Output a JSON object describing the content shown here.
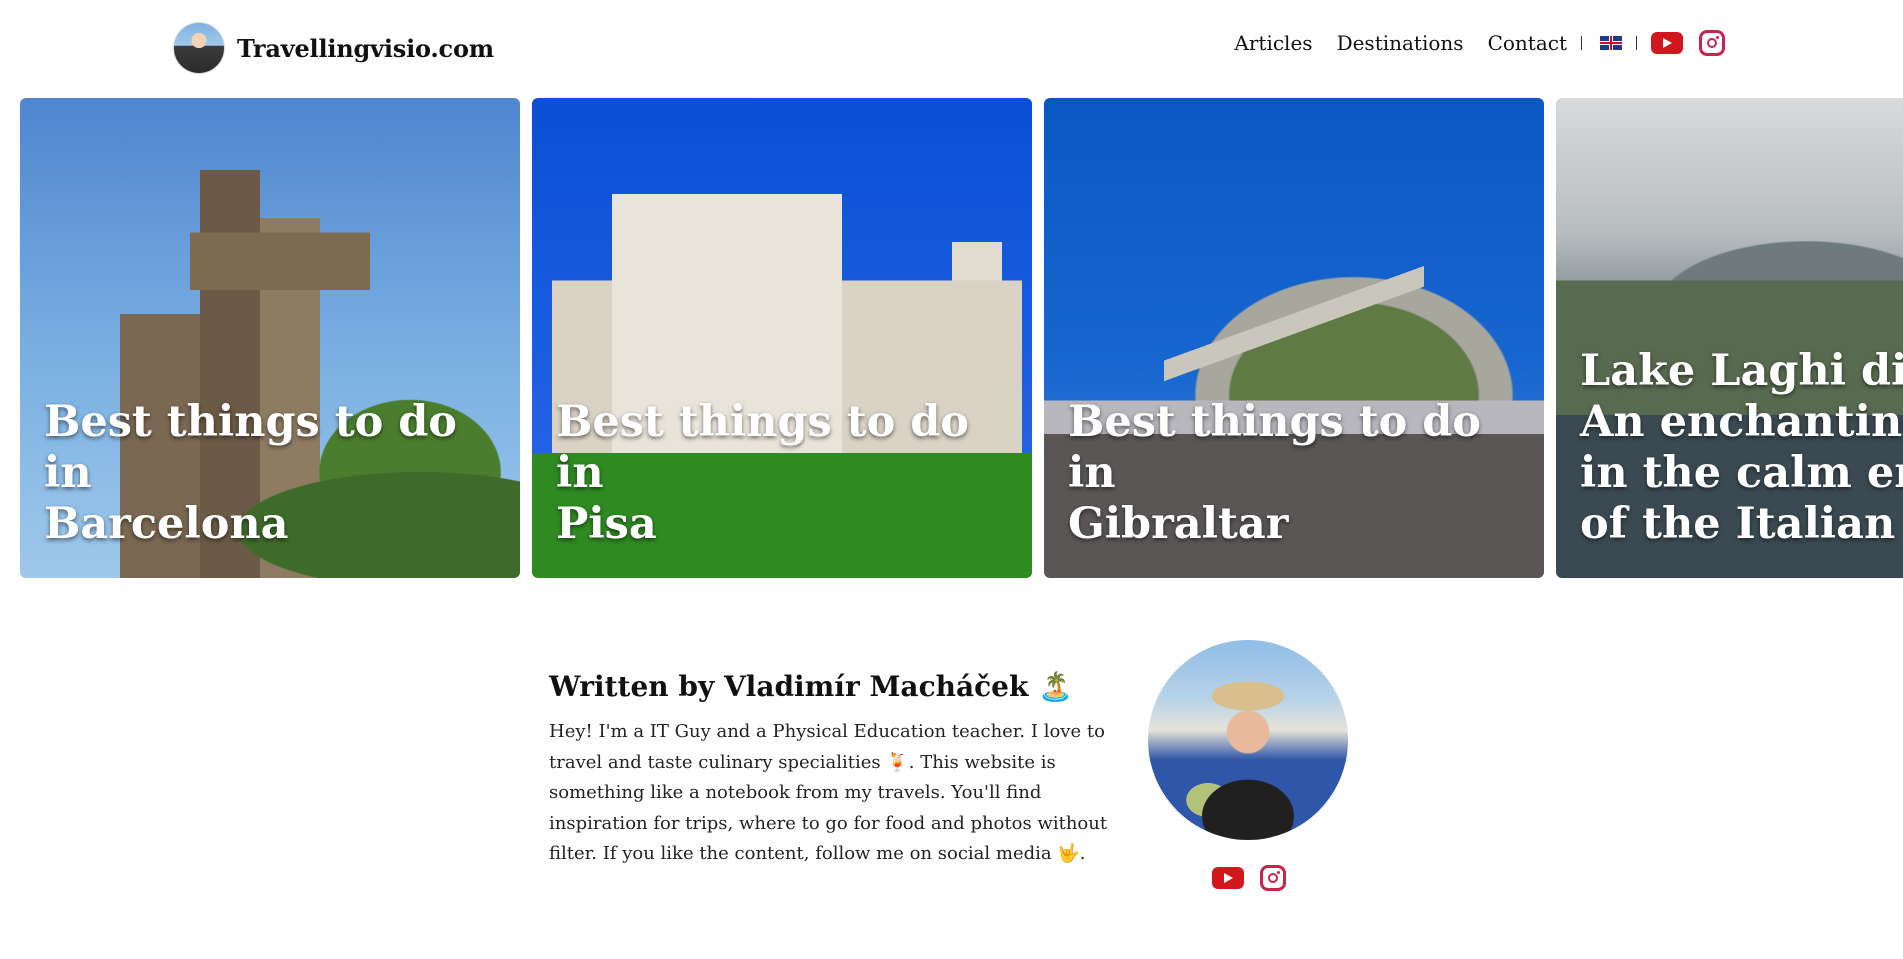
{
  "header": {
    "site_name": "Travellingvisio.com",
    "nav": [
      "Articles",
      "Destinations",
      "Contact"
    ],
    "language": "English",
    "icons": [
      "uk-flag-icon",
      "youtube-icon",
      "instagram-icon"
    ]
  },
  "cards": [
    {
      "title": "Best things to do in\nBarcelona"
    },
    {
      "title": "Best things to do in\nPisa"
    },
    {
      "title": "Best things to do in\nGibraltar"
    },
    {
      "title": "Lake Laghi di Fu\nAn enchanting v\nin the calm emb\nof the Italian Alp"
    }
  ],
  "author": {
    "heading": "Written by Vladimír Macháček 🏝️",
    "bio": "Hey! I'm a IT Guy and a Physical Education teacher. I love to travel and taste culinary specialities 🍹. This website is something like a notebook from my travels. You'll find inspiration for trips, where to go for food and photos without filter. If you like the content, follow me on social media 🤟.",
    "social_icons": [
      "youtube-icon",
      "instagram-icon"
    ]
  },
  "colors": {
    "youtube": "#d1171b",
    "instagram": "#c7254e",
    "text": "#111111"
  }
}
